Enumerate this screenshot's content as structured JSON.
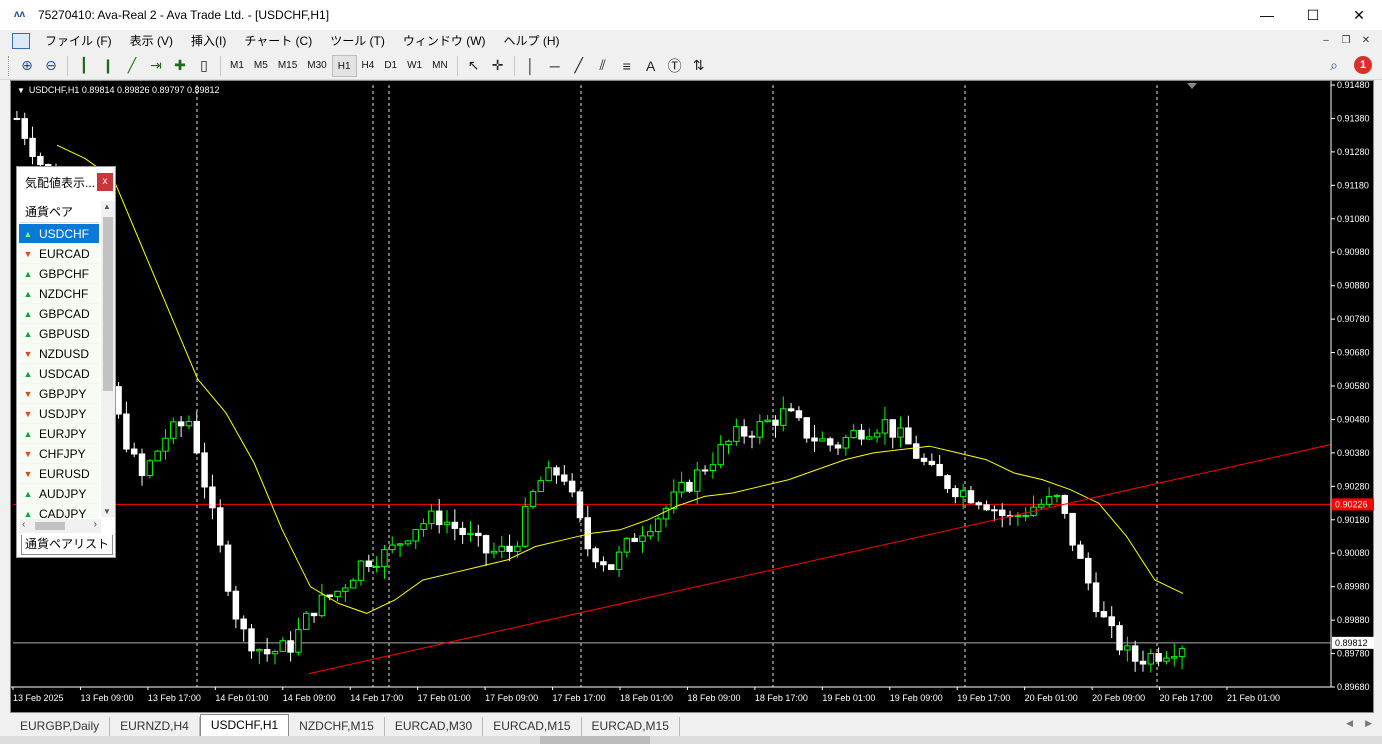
{
  "window": {
    "title": "75270410: Ava-Real 2 - Ava Trade Ltd. - [USDCHF,H1]",
    "app_icon": "ava-logo-icon",
    "controls": [
      "minimize-icon",
      "maximize-icon",
      "close-icon"
    ]
  },
  "menu": {
    "items": [
      "ファイル (F)",
      "表示 (V)",
      "挿入(I)",
      "チャート (C)",
      "ツール (T)",
      "ウィンドウ (W)",
      "ヘルプ (H)"
    ]
  },
  "toolbar": {
    "periods": [
      "M1",
      "M5",
      "M15",
      "M30",
      "H1",
      "H4",
      "D1",
      "W1",
      "MN"
    ],
    "active_period": "H1",
    "notification_count": "1",
    "tools": [
      "zoom-in-icon",
      "zoom-out-icon",
      "bar-chart-icon",
      "candlestick-icon",
      "line-chart-icon",
      "auto-scroll-icon",
      "chart-shift-icon",
      "indicators-icon",
      "cursor-icon",
      "crosshair-icon",
      "vertical-line-icon",
      "horizontal-line-icon",
      "trendline-icon",
      "equidistant-channel-icon",
      "fibonacci-icon",
      "text-icon",
      "text-label-icon",
      "arrows-icon",
      "search-icon",
      "notifications-icon"
    ],
    "text_tool": "A"
  },
  "chart": {
    "header": "USDCHF,H1  0.89814 0.89826 0.89797 0.89812",
    "bid_label": "0.89812",
    "line_label": "0.90226",
    "colors": {
      "background": "#000000",
      "bull": "#00ff00",
      "bear": "#ffffff",
      "ma": "#ffff00",
      "trend": "#ff0000",
      "text": "#ffffff"
    }
  },
  "chart_data": {
    "type": "candlestick",
    "symbol": "USDCHF",
    "timeframe": "H1",
    "ylim": [
      0.8968,
      0.9148
    ],
    "y_ticks": [
      "0.91480",
      "0.91380",
      "0.91280",
      "0.91180",
      "0.91080",
      "0.90980",
      "0.90880",
      "0.90780",
      "0.90680",
      "0.90580",
      "0.90480",
      "0.90380",
      "0.90280",
      "0.90180",
      "0.90080",
      "0.89980",
      "0.89880",
      "0.89780",
      "0.89680"
    ],
    "x_labels": [
      "13 Feb 2025",
      "13 Feb 09:00",
      "13 Feb 17:00",
      "14 Feb 01:00",
      "14 Feb 09:00",
      "14 Feb 17:00",
      "17 Feb 01:00",
      "17 Feb 09:00",
      "17 Feb 17:00",
      "18 Feb 01:00",
      "18 Feb 09:00",
      "18 Feb 17:00",
      "19 Feb 01:00",
      "19 Feb 09:00",
      "19 Feb 17:00",
      "20 Feb 01:00",
      "20 Feb 09:00",
      "20 Feb 17:00",
      "21 Feb 01:00"
    ],
    "close_path": [
      0.9138,
      0.9124,
      0.9112,
      0.9085,
      0.905,
      0.903,
      0.9043,
      0.9048,
      0.9015,
      0.8985,
      0.8978,
      0.898,
      0.8992,
      0.8997,
      0.9006,
      0.9008,
      0.9016,
      0.9019,
      0.9014,
      0.9008,
      0.9009,
      0.9029,
      0.9033,
      0.901,
      0.9004,
      0.9014,
      0.902,
      0.9028,
      0.9036,
      0.9043,
      0.9046,
      0.905,
      0.9043,
      0.904,
      0.9045,
      0.9047,
      0.904,
      0.9031,
      0.9027,
      0.9024,
      0.9018,
      0.9022,
      0.9024,
      0.9003,
      0.8985,
      0.8976,
      0.8978,
      0.8981
    ],
    "moving_average": [
      0.913,
      0.9126,
      0.912,
      0.91,
      0.908,
      0.906,
      0.905,
      0.9035,
      0.9015,
      0.8998,
      0.8993,
      0.899,
      0.8994,
      0.9,
      0.9002,
      0.9004,
      0.9006,
      0.901,
      0.9012,
      0.9014,
      0.9015,
      0.9018,
      0.9022,
      0.9025,
      0.9026,
      0.9028,
      0.903,
      0.9033,
      0.9036,
      0.9038,
      0.9039,
      0.904,
      0.9038,
      0.9036,
      0.9032,
      0.903,
      0.9027,
      0.9023,
      0.9013,
      0.9,
      0.8996
    ],
    "horizontal_line": 0.90226,
    "bid_line": 0.89812,
    "trendline": {
      "from": [
        "14 Feb 09:00",
        0.8972
      ],
      "to": [
        "21 Feb 06:00",
        0.90405
      ]
    },
    "period_separators": [
      "14 Feb 00:00",
      "17 Feb 00:00",
      "17 Feb 01:00",
      "18 Feb 00:00",
      "19 Feb 00:00",
      "20 Feb 00:00",
      "21 Feb 00:00"
    ],
    "grid": false
  },
  "market_watch": {
    "title": "気配値表示...",
    "column_header": "通貨ペア",
    "tab_label": "通貨ペアリスト",
    "rows": [
      {
        "symbol": "USDCHF",
        "dir": "up",
        "selected": true
      },
      {
        "symbol": "EURCAD",
        "dir": "down",
        "selected": false
      },
      {
        "symbol": "GBPCHF",
        "dir": "up",
        "selected": false
      },
      {
        "symbol": "NZDCHF",
        "dir": "up",
        "selected": false
      },
      {
        "symbol": "GBPCAD",
        "dir": "up",
        "selected": false
      },
      {
        "symbol": "GBPUSD",
        "dir": "up",
        "selected": false
      },
      {
        "symbol": "NZDUSD",
        "dir": "down",
        "selected": false
      },
      {
        "symbol": "USDCAD",
        "dir": "up",
        "selected": false
      },
      {
        "symbol": "GBPJPY",
        "dir": "down",
        "selected": false
      },
      {
        "symbol": "USDJPY",
        "dir": "down",
        "selected": false
      },
      {
        "symbol": "EURJPY",
        "dir": "up",
        "selected": false
      },
      {
        "symbol": "CHFJPY",
        "dir": "down",
        "selected": false
      },
      {
        "symbol": "EURUSD",
        "dir": "down",
        "selected": false
      },
      {
        "symbol": "AUDJPY",
        "dir": "up",
        "selected": false
      },
      {
        "symbol": "CADJPY",
        "dir": "up",
        "selected": false
      }
    ]
  },
  "tabs": [
    "EURGBP,Daily",
    "EURNZD,H4",
    "USDCHF,H1",
    "NZDCHF,M15",
    "EURCAD,M30",
    "EURCAD,M15",
    "EURCAD,M15"
  ],
  "active_tab": "USDCHF,H1"
}
